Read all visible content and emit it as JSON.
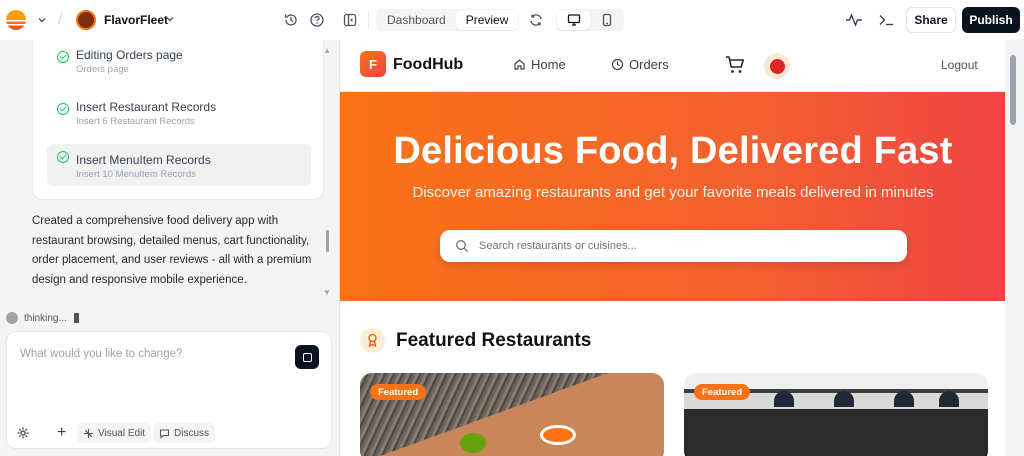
{
  "topbar": {
    "project_name": "FlavorFleet",
    "view_tabs": [
      "Dashboard",
      "Preview"
    ],
    "active_tab": "Preview",
    "share_label": "Share",
    "publish_label": "Publish"
  },
  "tasks": [
    {
      "title": "Editing Orders page",
      "subtitle": "Orders page"
    },
    {
      "title": "Insert Restaurant Records",
      "subtitle": "Insert 6 Restaurant Records"
    },
    {
      "title": "Insert MenuItem Records",
      "subtitle": "Insert 10 MenuItem Records"
    }
  ],
  "summary": "Created a comprehensive food delivery app with restaurant browsing, detailed menus, cart functionality, order placement, and user reviews - all with a premium design and responsive mobile experience.",
  "status": {
    "thinking": "thinking..."
  },
  "composer": {
    "placeholder": "What would you like to change?",
    "visual_edit_label": "Visual Edit",
    "discuss_label": "Discuss"
  },
  "app": {
    "brand_initial": "F",
    "brand_name": "FoodHub",
    "nav": {
      "home": "Home",
      "orders": "Orders",
      "logout": "Logout"
    },
    "hero": {
      "title": "Delicious Food, Delivered Fast",
      "subtitle": "Discover amazing restaurants and get your favorite meals delivered in minutes",
      "search_placeholder": "Search restaurants or cuisines..."
    },
    "featured_title": "Featured Restaurants",
    "cards": [
      {
        "badge": "Featured"
      },
      {
        "badge": "Featured"
      }
    ]
  },
  "colors": {
    "accent": "#f97316",
    "accent_end": "#ef4444",
    "success": "#22c55e",
    "dark": "#0b1220"
  }
}
